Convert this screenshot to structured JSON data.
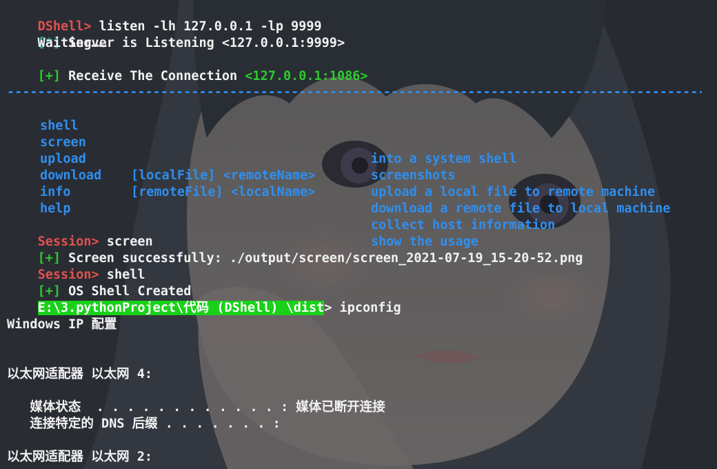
{
  "colors": {
    "prompt": "#e0524f",
    "success": "#2ccb2c",
    "info": "#24b8a8",
    "menu": "#2f8ff0",
    "text": "#f2f2f2",
    "path_highlight": "#1ad11a"
  },
  "listen": {
    "prompt": "DShell>",
    "command": " listen -lh 127.0.0.1 -lp 9999"
  },
  "server": {
    "tag": "[*]",
    "text": " Server is Listening <127.0.0.1:9999>"
  },
  "waiting": "    Waiting……",
  "receive": {
    "tag": "[+]",
    "text": " Receive The Connection ",
    "address": "<127.0.0.1:1086>"
  },
  "separator": "------------------------------------------------------------------------------------------------------------------------",
  "menu": [
    {
      "cmd": "shell",
      "args": "",
      "desc": "into a system shell"
    },
    {
      "cmd": "screen",
      "args": "",
      "desc": "screenshots"
    },
    {
      "cmd": "upload",
      "args": "[localFile] <remoteName>",
      "desc": "upload a local file to remote machine"
    },
    {
      "cmd": "download",
      "args": "[remoteFile] <localName>",
      "desc": "download a remote file to local machine"
    },
    {
      "cmd": "info",
      "args": "",
      "desc": "collect host information"
    },
    {
      "cmd": "help",
      "args": "",
      "desc": "show the usage"
    }
  ],
  "session_screen": {
    "prompt": "Session>",
    "command": " screen"
  },
  "screen_result": {
    "tag": "[+]",
    "text": " Screen successfully: ./output/screen/screen_2021-07-19_15-20-52.png"
  },
  "session_shell": {
    "prompt": "Session>",
    "command": " shell"
  },
  "shell_result": {
    "tag": "[+]",
    "text": " OS Shell Created"
  },
  "cmd_prompt": {
    "path": "E:\\3.pythonProject\\代码 (DShell) \\dist",
    "command": "> ipconfig"
  },
  "ipconfig": {
    "title": "Windows IP 配置",
    "adapter1": "以太网适配器 以太网 4:",
    "media_state": "   媒体状态  . . . . . . . . . . . . : 媒体已断开连接",
    "dns_suffix": "   连接特定的 DNS 后缀 . . . . . . . :",
    "adapter2": "以太网适配器 以太网 2:"
  }
}
